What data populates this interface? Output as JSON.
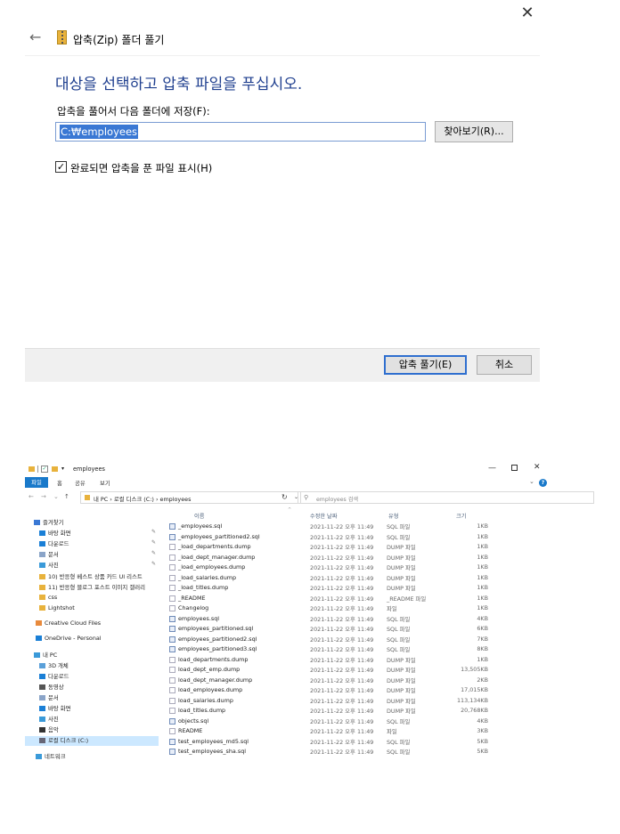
{
  "dialog": {
    "title": "압축(Zip) 폴더 풀기",
    "heading": "대상을 선택하고 압축 파일을 푸십시오.",
    "dest_label": "압축을 풀어서 다음 폴더에 저장(F):",
    "dest_value": "C:₩employees",
    "browse_label": "찾아보기(R)...",
    "check_label": "완료되면 압축을 푼 파일 표시(H)",
    "checked": true,
    "extract_label": "압축 풀기(E)",
    "cancel_label": "취소",
    "close_glyph": "✕",
    "back_glyph": "←"
  },
  "explorer": {
    "title": "employees",
    "ribbon_tabs": [
      "파일",
      "홈",
      "공유",
      "보기"
    ],
    "address": "내 PC  ›  로컬 디스크 (C:)  ›  employees",
    "search_placeholder": "employees 검색",
    "nav": [
      {
        "label": "즐겨찾기",
        "icon": "star-icon",
        "color": "#3a78d4"
      },
      {
        "label": "바탕 화면",
        "icon": "desktop-icon",
        "color": "#1a7fd6",
        "pinned": true
      },
      {
        "label": "다운로드",
        "icon": "download-icon",
        "color": "#1a7fd6",
        "pinned": true
      },
      {
        "label": "문서",
        "icon": "document-icon",
        "color": "#8aa4c8",
        "pinned": true
      },
      {
        "label": "사진",
        "icon": "picture-icon",
        "color": "#3a9ad9",
        "pinned": true
      },
      {
        "label": "10) 반응형 베스트 상품 카드 UI 리스트",
        "icon": "folder-icon",
        "color": "#e8b23c"
      },
      {
        "label": "11) 반응형 블로그 포스트 이미지 갤러리",
        "icon": "folder-icon",
        "color": "#e8b23c"
      },
      {
        "label": "css",
        "icon": "folder-icon",
        "color": "#e8b23c"
      },
      {
        "label": "Lightshot",
        "icon": "folder-icon",
        "color": "#e8b23c"
      },
      {
        "label": "Creative Cloud Files",
        "icon": "creative-cloud-icon",
        "color": "#e88a3c"
      },
      {
        "label": "OneDrive - Personal",
        "icon": "onedrive-icon",
        "color": "#1a7fd6"
      },
      {
        "label": "내 PC",
        "icon": "pc-icon",
        "color": "#3a9ad9"
      },
      {
        "label": "3D 개체",
        "icon": "3d-objects-icon",
        "color": "#5aa0d9"
      },
      {
        "label": "다운로드",
        "icon": "download-icon",
        "color": "#1a7fd6"
      },
      {
        "label": "동영상",
        "icon": "video-icon",
        "color": "#555"
      },
      {
        "label": "문서",
        "icon": "document-icon",
        "color": "#8aa4c8"
      },
      {
        "label": "바탕 화면",
        "icon": "desktop-icon",
        "color": "#1a7fd6"
      },
      {
        "label": "사진",
        "icon": "picture-icon",
        "color": "#3a9ad9"
      },
      {
        "label": "음악",
        "icon": "music-icon",
        "color": "#333"
      },
      {
        "label": "로컬 디스크 (C:)",
        "icon": "disk-icon",
        "color": "#667",
        "selected": true
      },
      {
        "label": "네트워크",
        "icon": "network-icon",
        "color": "#3a9ad9"
      }
    ],
    "columns": [
      "이름",
      "수정한 날짜",
      "유형",
      "크기"
    ],
    "files": [
      {
        "name": "_employees.sql",
        "date": "2021-11-22 오후 11:49",
        "type": "SQL 파일",
        "size": "1KB",
        "kind": "sql"
      },
      {
        "name": "_employees_partitioned2.sql",
        "date": "2021-11-22 오후 11:49",
        "type": "SQL 파일",
        "size": "1KB",
        "kind": "sql"
      },
      {
        "name": "_load_departments.dump",
        "date": "2021-11-22 오후 11:49",
        "type": "DUMP 파일",
        "size": "1KB",
        "kind": "file"
      },
      {
        "name": "_load_dept_manager.dump",
        "date": "2021-11-22 오후 11:49",
        "type": "DUMP 파일",
        "size": "1KB",
        "kind": "file"
      },
      {
        "name": "_load_employees.dump",
        "date": "2021-11-22 오후 11:49",
        "type": "DUMP 파일",
        "size": "1KB",
        "kind": "file"
      },
      {
        "name": "_load_salaries.dump",
        "date": "2021-11-22 오후 11:49",
        "type": "DUMP 파일",
        "size": "1KB",
        "kind": "file"
      },
      {
        "name": "_load_titles.dump",
        "date": "2021-11-22 오후 11:49",
        "type": "DUMP 파일",
        "size": "1KB",
        "kind": "file"
      },
      {
        "name": "_README",
        "date": "2021-11-22 오후 11:49",
        "type": "_README 파일",
        "size": "1KB",
        "kind": "file"
      },
      {
        "name": "Changelog",
        "date": "2021-11-22 오후 11:49",
        "type": "파일",
        "size": "1KB",
        "kind": "file"
      },
      {
        "name": "employees.sql",
        "date": "2021-11-22 오후 11:49",
        "type": "SQL 파일",
        "size": "4KB",
        "kind": "sql"
      },
      {
        "name": "employees_partitioned.sql",
        "date": "2021-11-22 오후 11:49",
        "type": "SQL 파일",
        "size": "6KB",
        "kind": "sql"
      },
      {
        "name": "employees_partitioned2.sql",
        "date": "2021-11-22 오후 11:49",
        "type": "SQL 파일",
        "size": "7KB",
        "kind": "sql"
      },
      {
        "name": "employees_partitioned3.sql",
        "date": "2021-11-22 오후 11:49",
        "type": "SQL 파일",
        "size": "8KB",
        "kind": "sql"
      },
      {
        "name": "load_departments.dump",
        "date": "2021-11-22 오후 11:49",
        "type": "DUMP 파일",
        "size": "1KB",
        "kind": "file"
      },
      {
        "name": "load_dept_emp.dump",
        "date": "2021-11-22 오후 11:49",
        "type": "DUMP 파일",
        "size": "13,505KB",
        "kind": "file"
      },
      {
        "name": "load_dept_manager.dump",
        "date": "2021-11-22 오후 11:49",
        "type": "DUMP 파일",
        "size": "2KB",
        "kind": "file"
      },
      {
        "name": "load_employees.dump",
        "date": "2021-11-22 오후 11:49",
        "type": "DUMP 파일",
        "size": "17,015KB",
        "kind": "file"
      },
      {
        "name": "load_salaries.dump",
        "date": "2021-11-22 오후 11:49",
        "type": "DUMP 파일",
        "size": "113,134KB",
        "kind": "file"
      },
      {
        "name": "load_titles.dump",
        "date": "2021-11-22 오후 11:49",
        "type": "DUMP 파일",
        "size": "20,768KB",
        "kind": "file"
      },
      {
        "name": "objects.sql",
        "date": "2021-11-22 오후 11:49",
        "type": "SQL 파일",
        "size": "4KB",
        "kind": "sql"
      },
      {
        "name": "README",
        "date": "2021-11-22 오후 11:49",
        "type": "파일",
        "size": "3KB",
        "kind": "file"
      },
      {
        "name": "test_employees_md5.sql",
        "date": "2021-11-22 오후 11:49",
        "type": "SQL 파일",
        "size": "5KB",
        "kind": "sql"
      },
      {
        "name": "test_employees_sha.sql",
        "date": "2021-11-22 오후 11:49",
        "type": "SQL 파일",
        "size": "5KB",
        "kind": "sql"
      }
    ]
  }
}
